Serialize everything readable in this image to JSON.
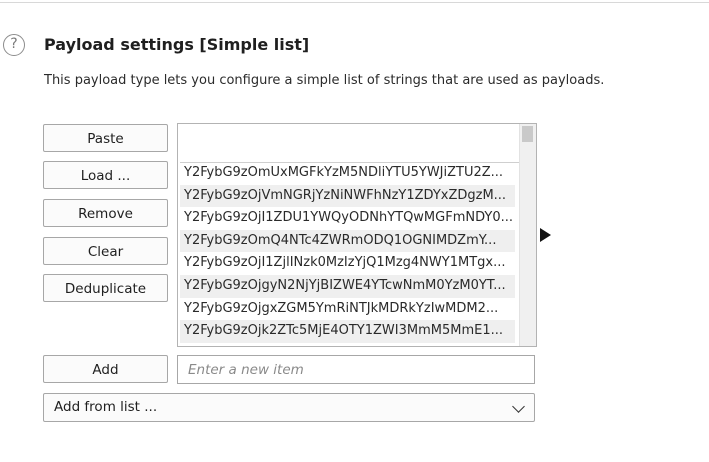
{
  "section": {
    "title": "Payload settings [Simple list]",
    "description": "This payload type lets you configure a simple list of strings that are used as payloads.",
    "help_icon": "question-circle-icon"
  },
  "buttons": {
    "paste": "Paste",
    "load": "Load ...",
    "remove": "Remove",
    "clear": "Clear",
    "deduplicate": "Deduplicate",
    "add": "Add"
  },
  "list": {
    "edit_value": "",
    "items": [
      "Y2FybG9zOmUxMGFkYzM5NDliYTU5YWJiZTU2Z...",
      "Y2FybG9zOjVmNGRjYzNiNWFhNzY1ZDYxZDgzM...",
      "Y2FybG9zOjI1ZDU1YWQyODNhYTQwMGFmNDY0...",
      "Y2FybG9zOmQ4NTc4ZWRmODQ1OGNIMDZmY...",
      "Y2FybG9zOjI1ZjlINzk0MzIzYjQ1Mzg4NWY1MTgx...",
      "Y2FybG9zOjgyN2NjYjBIZWE4YTcwNmM0YzM0YT...",
      "Y2FybG9zOjgxZGM5YmRiNTJkMDRkYzIwMDM2...",
      "Y2FybG9zOjk2ZTc5MjE4OTY1ZWI3MmM5MmE1..."
    ],
    "side_arrow_icon": "triangle-right-icon"
  },
  "new_item": {
    "placeholder": "Enter a new item",
    "value": ""
  },
  "add_from_list": {
    "label": "Add from list ...",
    "icon": "chevron-down-icon"
  }
}
